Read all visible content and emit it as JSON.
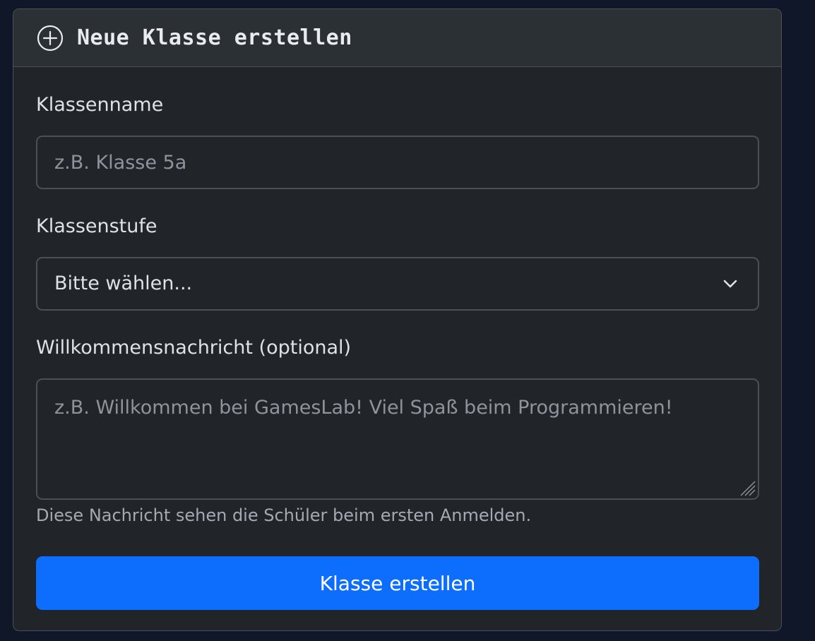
{
  "colors": {
    "page_background": "#0f1728",
    "card_background": "#212529",
    "header_background": "#2b3035",
    "border": "#495057",
    "primary_button": "#0d6efd"
  },
  "card": {
    "header": {
      "icon": "plus-circle-icon",
      "title": "Neue Klasse erstellen"
    }
  },
  "form": {
    "name": {
      "label": "Klassenname",
      "value": "",
      "placeholder": "z.B. Klasse 5a"
    },
    "grade": {
      "label": "Klassenstufe",
      "selected": "Bitte wählen...",
      "icon": "chevron-down-icon"
    },
    "welcome": {
      "label": "Willkommensnachricht (optional)",
      "value": "",
      "placeholder": "z.B. Willkommen bei GamesLab! Viel Spaß beim Programmieren!",
      "help": "Diese Nachricht sehen die Schüler beim ersten Anmelden."
    },
    "submit_label": "Klasse erstellen"
  }
}
